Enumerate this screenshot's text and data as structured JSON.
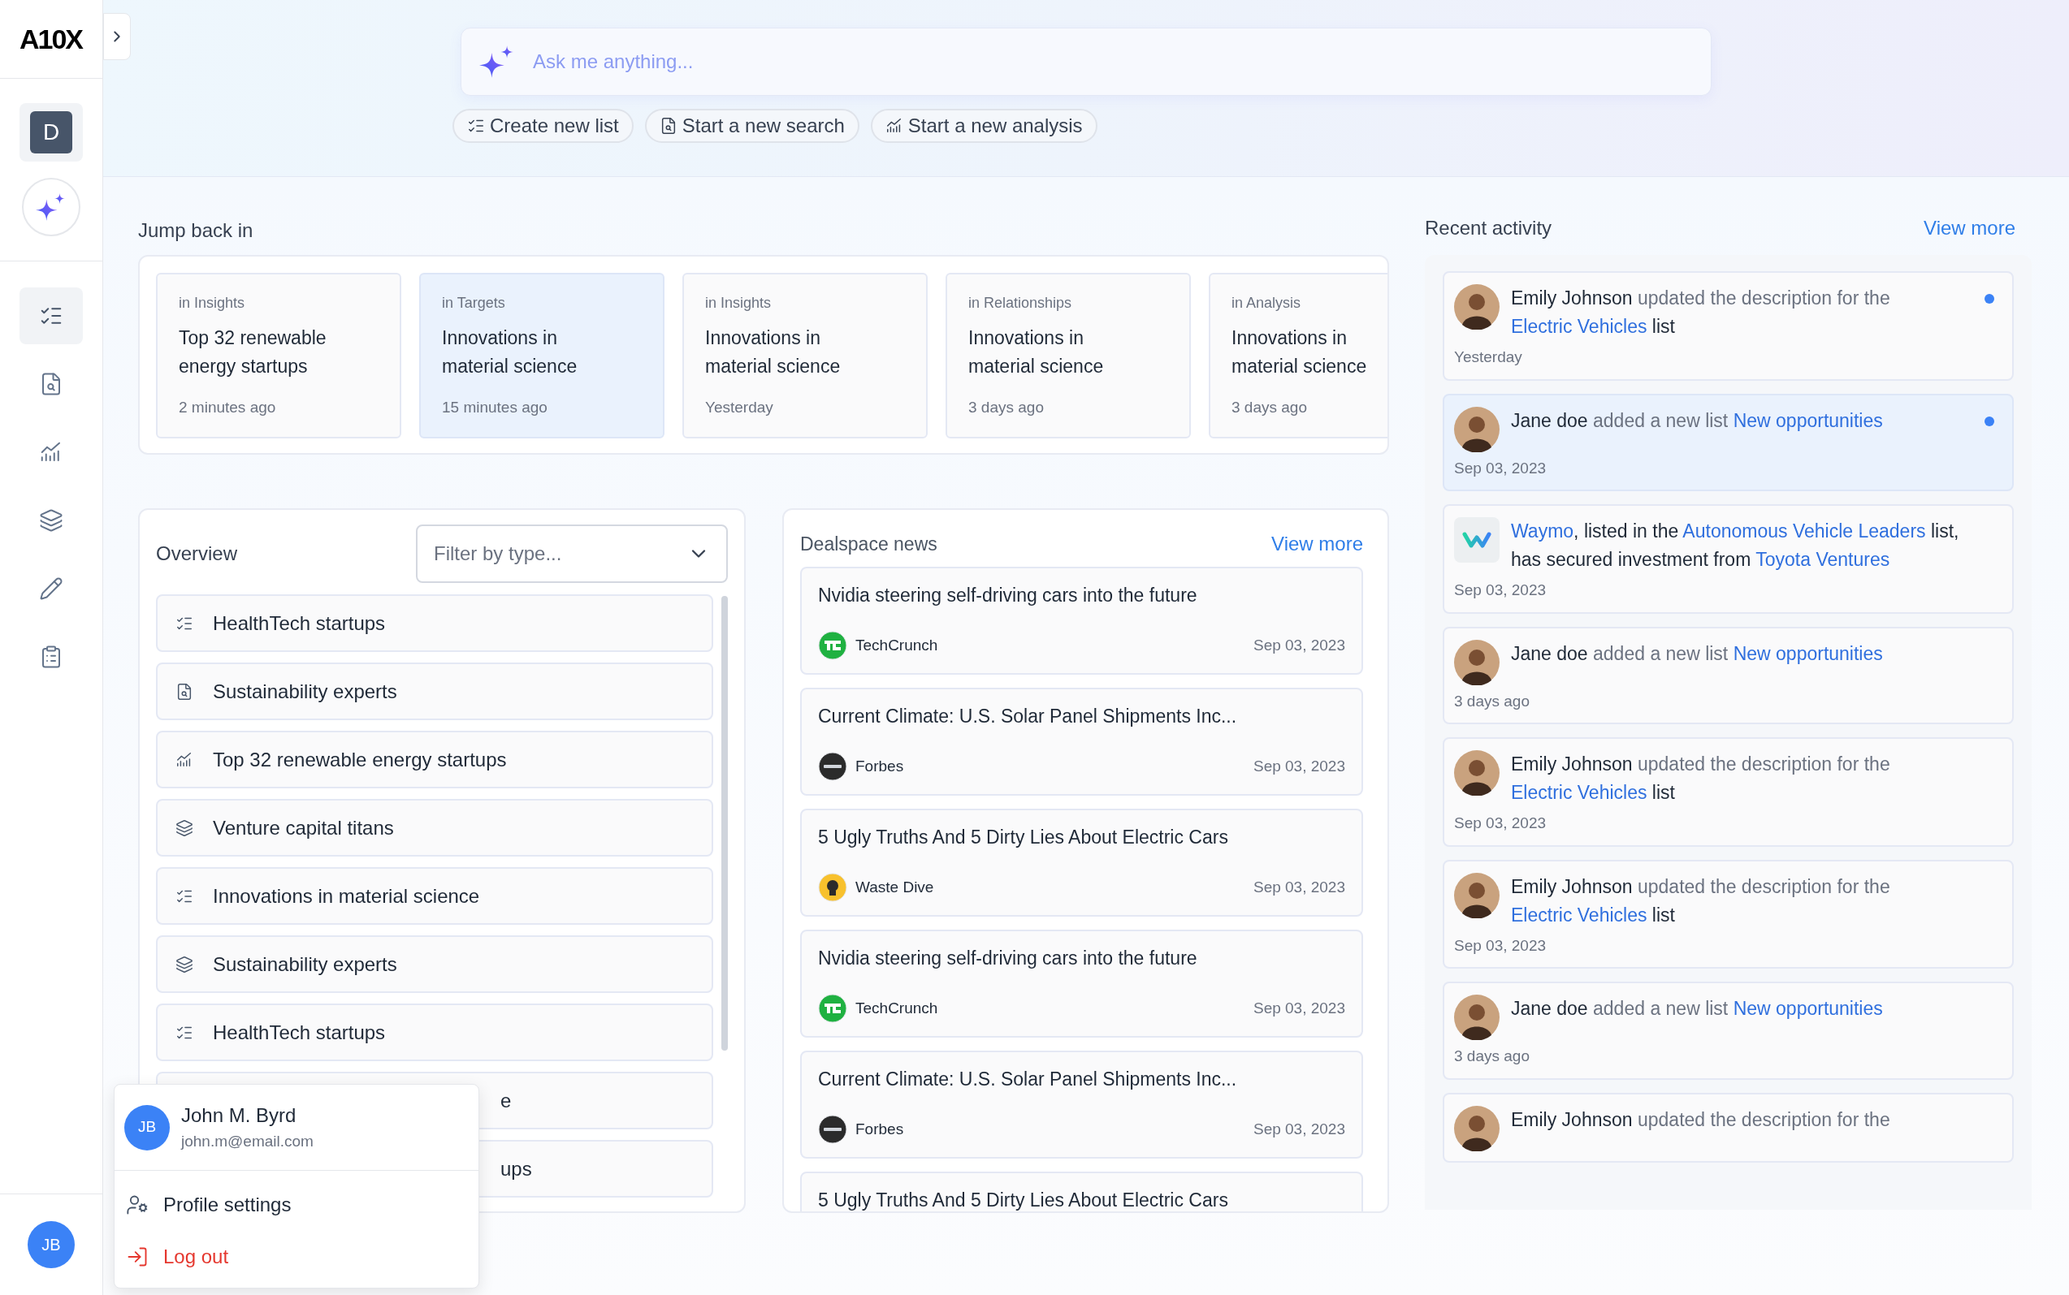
{
  "brand": {
    "logo": "A10X"
  },
  "sidebar": {
    "workspace_initial": "D",
    "items": [
      {
        "kind": "lists",
        "selected": true
      },
      {
        "kind": "search",
        "selected": false
      },
      {
        "kind": "analysis",
        "selected": false
      },
      {
        "kind": "layers",
        "selected": false
      },
      {
        "kind": "edit",
        "selected": false
      },
      {
        "kind": "notes",
        "selected": false
      }
    ],
    "user_initials": "JB"
  },
  "search": {
    "placeholder": "Ask me anything..."
  },
  "quick_actions": [
    {
      "kind": "list",
      "label": "Create new list"
    },
    {
      "kind": "search",
      "label": "Start a new search"
    },
    {
      "kind": "analysis",
      "label": "Start a new analysis"
    }
  ],
  "jump_back_in": {
    "title": "Jump back in",
    "cards": [
      {
        "context": "in Insights",
        "title": "Top 32 renewable energy startups",
        "time": "2 minutes ago",
        "selected": false
      },
      {
        "context": "in Targets",
        "title": "Innovations in material science",
        "time": "15 minutes ago",
        "selected": true
      },
      {
        "context": "in Insights",
        "title": "Innovations in material science",
        "time": "Yesterday",
        "selected": false
      },
      {
        "context": "in Relationships",
        "title": "Innovations in material science",
        "time": "3 days ago",
        "selected": false
      },
      {
        "context": "in Analysis",
        "title": "Innovations in material science",
        "time": "3 days ago",
        "selected": false
      }
    ]
  },
  "overview": {
    "title": "Overview",
    "filter": {
      "placeholder": "Filter by type..."
    },
    "items": [
      {
        "kind": "list",
        "label": "HealthTech startups",
        "covered": false
      },
      {
        "kind": "search",
        "label": "Sustainability experts",
        "covered": false
      },
      {
        "kind": "analysis",
        "label": "Top 32 renewable energy startups",
        "covered": false
      },
      {
        "kind": "layers",
        "label": "Venture capital titans",
        "covered": false
      },
      {
        "kind": "list",
        "label": "Innovations in material science",
        "covered": false
      },
      {
        "kind": "layers",
        "label": "Sustainability experts",
        "covered": false
      },
      {
        "kind": "list",
        "label": "HealthTech startups",
        "covered": false
      },
      {
        "label": "e",
        "covered": true
      },
      {
        "label": "ups",
        "covered": true
      }
    ]
  },
  "news": {
    "title": "Dealspace news",
    "view_more": "View more",
    "items": [
      {
        "title": "Nvidia steering self-driving cars into the future",
        "kind": "techcrunch",
        "source": "TechCrunch",
        "date": "Sep 03, 2023"
      },
      {
        "title": "Current Climate: U.S. Solar Panel Shipments Inc...",
        "kind": "forbes",
        "source": "Forbes",
        "date": "Sep 03, 2023"
      },
      {
        "title": "5 Ugly Truths And 5 Dirty Lies About Electric Cars",
        "kind": "wastedive",
        "source": "Waste Dive",
        "date": "Sep 03, 2023"
      },
      {
        "title": "Nvidia steering self-driving cars into the future",
        "kind": "techcrunch",
        "source": "TechCrunch",
        "date": "Sep 03, 2023"
      },
      {
        "title": "Current Climate: U.S. Solar Panel Shipments Inc...",
        "kind": "forbes",
        "source": "Forbes",
        "date": "Sep 03, 2023"
      },
      {
        "title": "5 Ugly Truths And 5 Dirty Lies About Electric Cars"
      }
    ]
  },
  "activity": {
    "title": "Recent activity",
    "view_more": "View more",
    "items": [
      {
        "kind": "person",
        "unread": true,
        "selected": false,
        "time": "Yesterday",
        "parts": [
          {
            "kind": "actor",
            "text": "Emily Johnson"
          },
          {
            "kind": "text",
            "text": " updated the description for the "
          },
          {
            "kind": "link",
            "text": "Electric Vehicles"
          },
          {
            "kind": "plain",
            "text": " list"
          }
        ]
      },
      {
        "kind": "person",
        "unread": true,
        "selected": true,
        "time": "Sep 03, 2023",
        "parts": [
          {
            "kind": "actor",
            "text": "Jane doe"
          },
          {
            "kind": "text",
            "text": " added a new list "
          },
          {
            "kind": "link",
            "text": "New opportunities"
          }
        ]
      },
      {
        "kind": "company",
        "unread": false,
        "selected": false,
        "time": "Sep 03, 2023",
        "parts": [
          {
            "kind": "link",
            "text": "Waymo"
          },
          {
            "kind": "plain",
            "text": ", listed in the "
          },
          {
            "kind": "link",
            "text": "Autonomous Vehicle Leaders"
          },
          {
            "kind": "plain",
            "text": " list, has secured investment from "
          },
          {
            "kind": "link",
            "text": "Toyota Ventures"
          }
        ]
      },
      {
        "kind": "person",
        "unread": false,
        "selected": false,
        "time": "3 days ago",
        "parts": [
          {
            "kind": "actor",
            "text": "Jane doe"
          },
          {
            "kind": "text",
            "text": " added a new list "
          },
          {
            "kind": "link",
            "text": "New opportunities"
          }
        ]
      },
      {
        "kind": "person",
        "unread": false,
        "selected": false,
        "time": "Sep 03, 2023",
        "parts": [
          {
            "kind": "actor",
            "text": "Emily Johnson"
          },
          {
            "kind": "text",
            "text": " updated the description for the "
          },
          {
            "kind": "link",
            "text": "Electric Vehicles"
          },
          {
            "kind": "plain",
            "text": " list"
          }
        ]
      },
      {
        "kind": "person",
        "unread": false,
        "selected": false,
        "time": "Sep 03, 2023",
        "parts": [
          {
            "kind": "actor",
            "text": "Emily Johnson"
          },
          {
            "kind": "text",
            "text": " updated the description for the "
          },
          {
            "kind": "link",
            "text": "Electric Vehicles"
          },
          {
            "kind": "plain",
            "text": " list"
          }
        ]
      },
      {
        "kind": "person",
        "unread": false,
        "selected": false,
        "time": "3 days ago",
        "parts": [
          {
            "kind": "actor",
            "text": "Jane doe"
          },
          {
            "kind": "text",
            "text": " added a new list "
          },
          {
            "kind": "link",
            "text": "New opportunities"
          }
        ]
      },
      {
        "kind": "person",
        "unread": false,
        "selected": false,
        "parts": [
          {
            "kind": "actor",
            "text": "Emily Johnson"
          },
          {
            "kind": "text",
            "text": " updated the description for the"
          }
        ]
      }
    ]
  },
  "user_menu": {
    "initials": "JB",
    "name": "John M. Byrd",
    "email": "john.m@email.com",
    "items": [
      {
        "kind": "settings",
        "label": "Profile settings"
      },
      {
        "kind": "logout",
        "label": "Log out"
      }
    ]
  }
}
